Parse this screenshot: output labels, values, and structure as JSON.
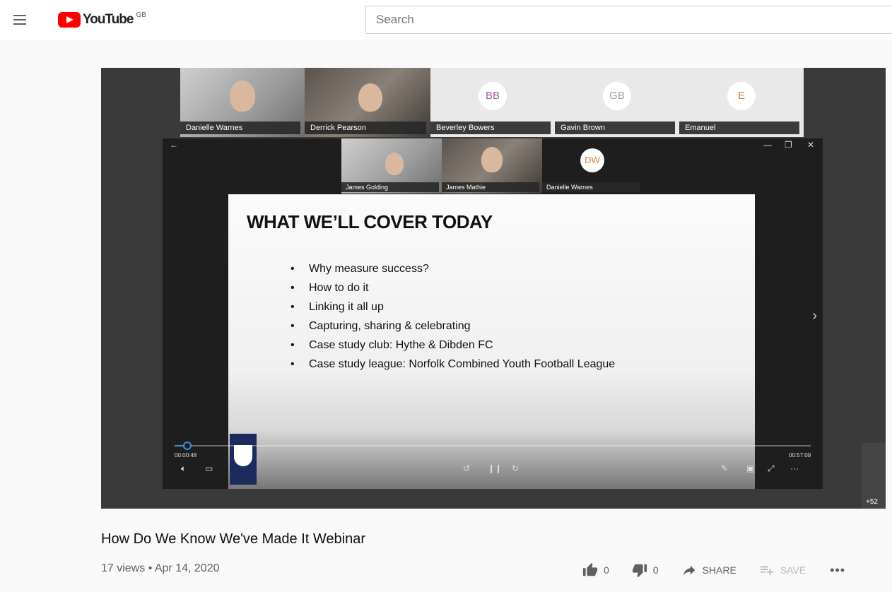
{
  "header": {
    "logo_text": "YouTube",
    "region": "GB",
    "search_placeholder": "Search"
  },
  "participants_top": [
    {
      "name": "Danielle Warnes",
      "initials": ""
    },
    {
      "name": "Derrick Pearson",
      "initials": ""
    },
    {
      "name": "Beverley Bowers",
      "initials": "BB"
    },
    {
      "name": "Gavin Brown",
      "initials": "GB"
    },
    {
      "name": "Emanuel",
      "initials": "E"
    }
  ],
  "participants_inner": [
    {
      "name": "James Golding",
      "initials": ""
    },
    {
      "name": "James Mathie",
      "initials": ""
    },
    {
      "name": "Danielle Warnes",
      "initials": "DW"
    }
  ],
  "slide": {
    "title": "WHAT WE’LL COVER TODAY",
    "bullets": [
      "Why measure success?",
      "How to do it",
      "Linking it all up",
      "Capturing, sharing & celebrating",
      "Case study club: Hythe & Dibden FC",
      "Case study league: Norfolk Combined Youth Football League"
    ]
  },
  "inner_player": {
    "current_time": "00:00:48",
    "duration": "00:57:09",
    "progress_fraction": 0.02
  },
  "overflow_count": "+52",
  "video": {
    "title": "How Do We Know We've Made It Webinar",
    "meta": "17 views • Apr 14, 2020",
    "likes": "0",
    "dislikes": "0",
    "share_label": "SHARE",
    "save_label": "SAVE"
  },
  "colors": {
    "brand_red": "#ff0000",
    "progress_blue": "#3b8fe8"
  }
}
